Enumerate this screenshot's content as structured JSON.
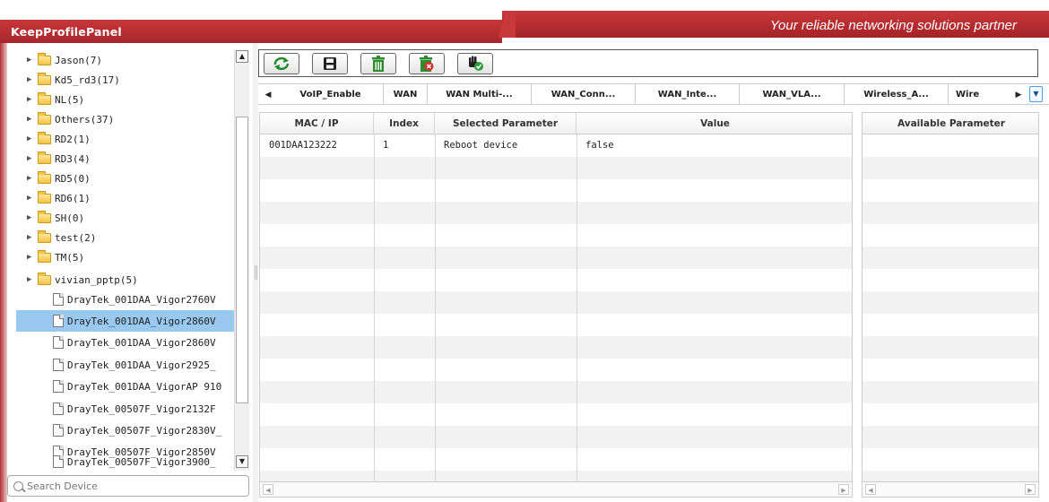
{
  "app": {
    "title": "KeepProfilePanel",
    "slogan": "Your reliable networking solutions partner",
    "brand_color": "#b8292d"
  },
  "tree": {
    "folders": [
      {
        "label": "Jason(7)"
      },
      {
        "label": "Kd5_rd3(17)"
      },
      {
        "label": "NL(5)"
      },
      {
        "label": "Others(37)"
      },
      {
        "label": "RD2(1)"
      },
      {
        "label": "RD3(4)"
      },
      {
        "label": "RD5(0)"
      },
      {
        "label": "RD6(1)"
      },
      {
        "label": "SH(0)"
      },
      {
        "label": "test(2)"
      },
      {
        "label": "TM(5)"
      },
      {
        "label": "vivian_pptp(5)"
      }
    ],
    "devices": [
      {
        "label": "DrayTek_001DAA_Vigor2760V",
        "selected": false
      },
      {
        "label": "DrayTek_001DAA_Vigor2860V",
        "selected": true
      },
      {
        "label": "DrayTek_001DAA_Vigor2860V",
        "selected": false
      },
      {
        "label": "DrayTek_001DAA_Vigor2925_",
        "selected": false
      },
      {
        "label": "DrayTek_001DAA_VigorAP 910",
        "selected": false
      },
      {
        "label": "DrayTek_00507F_Vigor2132F",
        "selected": false
      },
      {
        "label": "DrayTek_00507F_Vigor2830V_",
        "selected": false
      },
      {
        "label": "DrayTek_00507F_Vigor2850V",
        "selected": false
      },
      {
        "label": "DrayTek_00507F_Vigor3900_",
        "selected": false
      }
    ],
    "selection_color": "#99c9f1"
  },
  "search": {
    "placeholder": "Search Device"
  },
  "toolbar": {
    "buttons": [
      {
        "name": "refresh",
        "icon": "refresh-icon"
      },
      {
        "name": "save",
        "icon": "floppy-disk-icon"
      },
      {
        "name": "delete",
        "icon": "trash-icon"
      },
      {
        "name": "delete-selected",
        "icon": "trash-x-icon"
      },
      {
        "name": "apply",
        "icon": "hand-check-icon"
      }
    ]
  },
  "tabs": [
    {
      "label": "VoIP_Enable"
    },
    {
      "label": "WAN"
    },
    {
      "label": "WAN Multi-..."
    },
    {
      "label": "WAN_Conn..."
    },
    {
      "label": "WAN_Inte..."
    },
    {
      "label": "WAN_VLA..."
    },
    {
      "label": "Wireless_A..."
    },
    {
      "label": "Wire"
    }
  ],
  "grid": {
    "columns": [
      "MAC / IP",
      "Index",
      "Selected Parameter",
      "Value"
    ],
    "rows": [
      {
        "mac": "001DAA123222",
        "index": "1",
        "parameter": "Reboot device",
        "value": "false"
      }
    ]
  },
  "available": {
    "header": "Available Parameter"
  }
}
